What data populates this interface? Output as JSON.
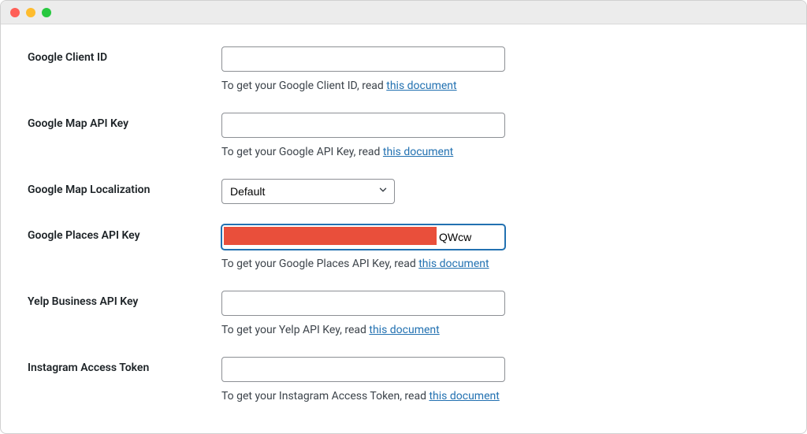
{
  "fields": {
    "google_client_id": {
      "label": "Google Client ID",
      "value": "",
      "help_prefix": "To get your Google Client ID, read ",
      "help_link": "this document"
    },
    "google_map_api_key": {
      "label": "Google Map API Key",
      "value": "",
      "help_prefix": "To get your Google API Key, read ",
      "help_link": "this document"
    },
    "google_map_localization": {
      "label": "Google Map Localization",
      "selected": "Default"
    },
    "google_places_api_key": {
      "label": "Google Places API Key",
      "value": "QWcw",
      "help_prefix": "To get your Google Places API Key, read ",
      "help_link": "this document"
    },
    "yelp_api_key": {
      "label": "Yelp Business API Key",
      "value": "",
      "help_prefix": "To get your Yelp API Key, read ",
      "help_link": "this document"
    },
    "instagram_token": {
      "label": "Instagram Access Token",
      "value": "",
      "help_prefix": "To get your Instagram Access Token, read ",
      "help_link": "this document"
    }
  }
}
